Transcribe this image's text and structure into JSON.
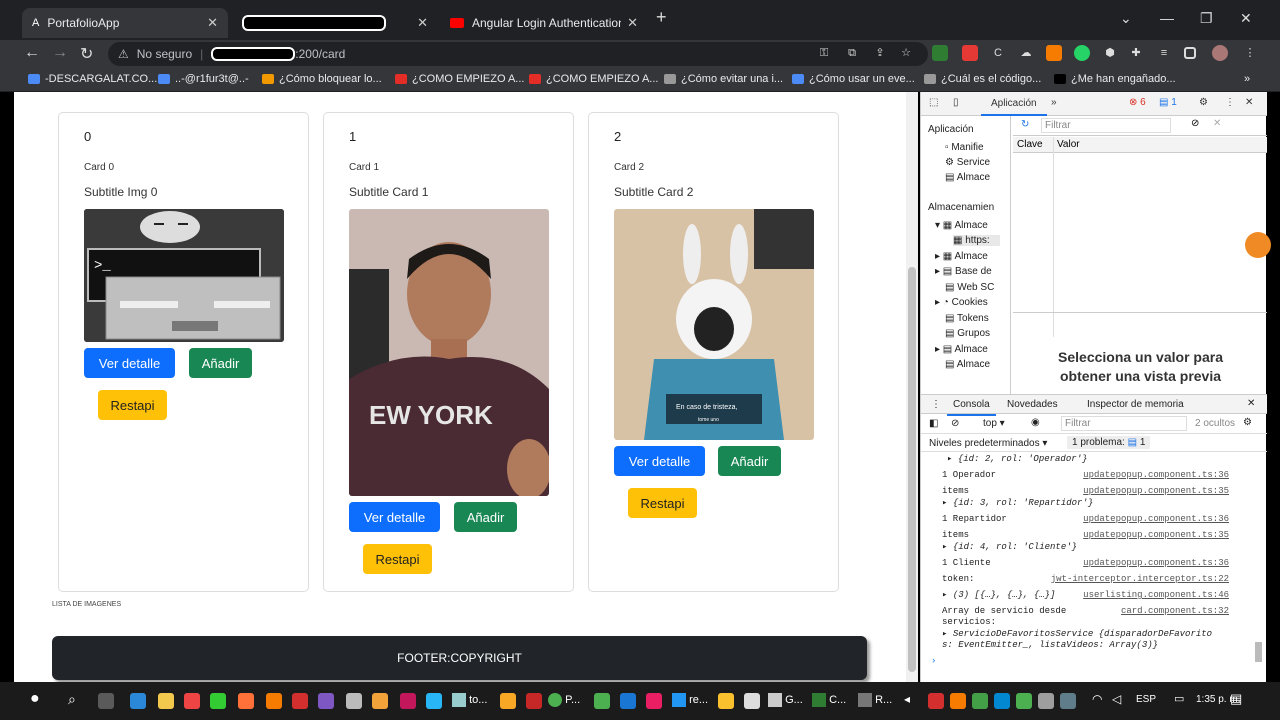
{
  "browser": {
    "tabs": [
      {
        "title": "PortafolioApp",
        "active": true
      },
      {
        "title": "",
        "active": false,
        "redacted": true
      },
      {
        "title": "Angular Login Authentication - Y",
        "active": false
      }
    ],
    "url_warning": "No seguro",
    "url_suffix": ":200/card",
    "bookmarks": [
      "-DESCARGALAT.CO...",
      "..-@r1fur3t@..-",
      "¿Cómo bloquear lo...",
      "¿COMO EMPIEZO A...",
      "¿COMO EMPIEZO A...",
      "¿Cómo evitar una i...",
      "¿Cómo usar un eve...",
      "¿Cuál es el código...",
      "¿Me han engañado..."
    ],
    "bookmark_colors": [
      "#4c8bf5",
      "#4c8bf5",
      "#f29900",
      "#e52d27",
      "#e52d27",
      "#999999",
      "#4c8bf5",
      "#999999",
      "#000000"
    ]
  },
  "page": {
    "cards": [
      {
        "number": "0",
        "title": "Card 0",
        "subtitle": "Subtitle Img 0",
        "detail": "Ver detalle",
        "add": "Añadir",
        "restore": "Restapi"
      },
      {
        "number": "1",
        "title": "Card 1",
        "subtitle": "Subtitle Card 1",
        "detail": "Ver detalle",
        "add": "Añadir",
        "restore": "Restapi"
      },
      {
        "number": "2",
        "title": "Card 2",
        "subtitle": "Subtitle Card 2",
        "detail": "Ver detalle",
        "add": "Añadir",
        "restore": "Restapi"
      }
    ],
    "tissue_text": "En caso de tristeza,",
    "tissue_sub": "tome uno",
    "shirt_text": "EW YORK",
    "lista": "LISTA DE IMAGENES",
    "footer": "FOOTER:COPYRIGHT"
  },
  "devtools": {
    "tab": "Aplicación",
    "errors": "6",
    "messages": "1",
    "app_title": "Aplicación",
    "app_items": [
      "Manifie",
      "Service",
      "Almace"
    ],
    "storage_title": "Almacenamien",
    "storage_items": [
      "Almace",
      "https:",
      "Almace",
      "Base de",
      "Web SC",
      "Cookies",
      "Tokens",
      "Grupos",
      "Almace",
      "Almace"
    ],
    "filter": "Filtrar",
    "col_key": "Clave",
    "col_value": "Valor",
    "preview": "Selecciona un valor para obtener una vista previa",
    "console_tabs": [
      "Consola",
      "Novedades",
      "Inspector de memoria"
    ],
    "context": "top",
    "filter2": "Filtrar",
    "hidden": "2 ocultos",
    "levels": "Niveles predeterminados ▾",
    "problems": "1 problema:",
    "problems_count": "1",
    "log": [
      {
        "text": "▸ {id: 2, rol: 'Operador'}",
        "link": ""
      },
      {
        "text": "1 Operador",
        "link": "updatepopup.component.ts:36"
      },
      {
        "text": "items",
        "link": "updatepopup.component.ts:35"
      },
      {
        "text": " ▸ {id: 3, rol: 'Repartidor'}",
        "link": ""
      },
      {
        "text": "1 Repartidor",
        "link": "updatepopup.component.ts:36"
      },
      {
        "text": "items",
        "link": "updatepopup.component.ts:35"
      },
      {
        "text": " ▸ {id: 4, rol: 'Cliente'}",
        "link": ""
      },
      {
        "text": "1 Cliente",
        "link": "updatepopup.component.ts:36"
      },
      {
        "text": "token:",
        "link": "jwt-interceptor.interceptor.ts:22"
      },
      {
        "text": " ▸ (3) [{…}, {…}, {…}]",
        "link": "userlisting.component.ts:46"
      },
      {
        "text": "Array de servicio desde",
        "link": "card.component.ts:32"
      },
      {
        "text": "servicios:",
        "link": ""
      },
      {
        "text": " ▸ ServicioDeFavoritosService {disparadorDeFavorito",
        "link": ""
      },
      {
        "text": "   s: EventEmitter_, listaVideos: Array(3)}",
        "link": ""
      }
    ]
  },
  "taskbar": {
    "lang": "ESP",
    "time": "1:35 p. m.",
    "apps": [
      "to...",
      "P...",
      "re...",
      "G...",
      "C...",
      "R..."
    ]
  }
}
